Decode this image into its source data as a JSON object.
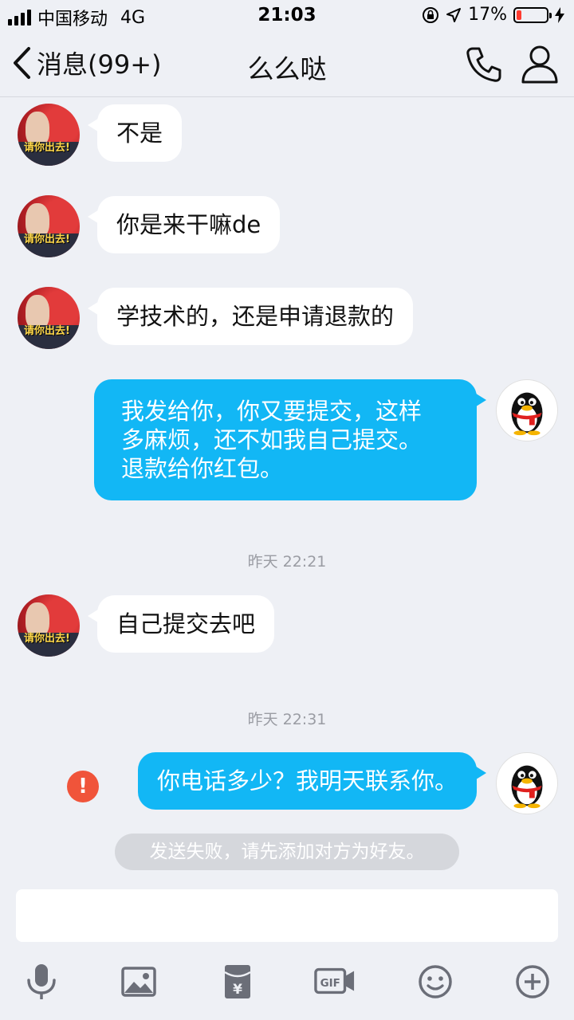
{
  "status_bar": {
    "carrier": "中国移动",
    "network": "4G",
    "time": "21:03",
    "battery": "17%",
    "battery_level": 0.17,
    "battery_color": "#ff3b30"
  },
  "nav": {
    "back_label": "消息(99+)",
    "title": "么么哒"
  },
  "messages": [
    {
      "from": "peer",
      "text": "不是"
    },
    {
      "from": "peer",
      "text": "你是来干嘛de"
    },
    {
      "from": "peer",
      "text": "学技术的，还是申请退款的"
    },
    {
      "from": "me",
      "lines": [
        "我发给你，你又要提交，这样",
        "多麻烦，还不如我自己提交。",
        "退款给你红包。"
      ]
    },
    {
      "type": "timestamp",
      "text": "昨天 22:21"
    },
    {
      "from": "peer",
      "text": "自己提交去吧"
    },
    {
      "type": "timestamp",
      "text": "昨天 22:31"
    },
    {
      "from": "me",
      "text": "你电话多少？我明天联系你。",
      "status": "failed"
    }
  ],
  "peer_avatar_caption": "请你出去!",
  "fail_icon_glyph": "!",
  "notice": "发送失败，请先添加对方为好友。",
  "toolbar": {
    "items": [
      "microphone-icon",
      "image-icon",
      "red-packet-icon",
      "gif-icon",
      "emoji-icon",
      "plus-icon"
    ]
  },
  "colors": {
    "accent": "#12b7f5",
    "background": "#eef0f5",
    "error": "#f0543a"
  }
}
